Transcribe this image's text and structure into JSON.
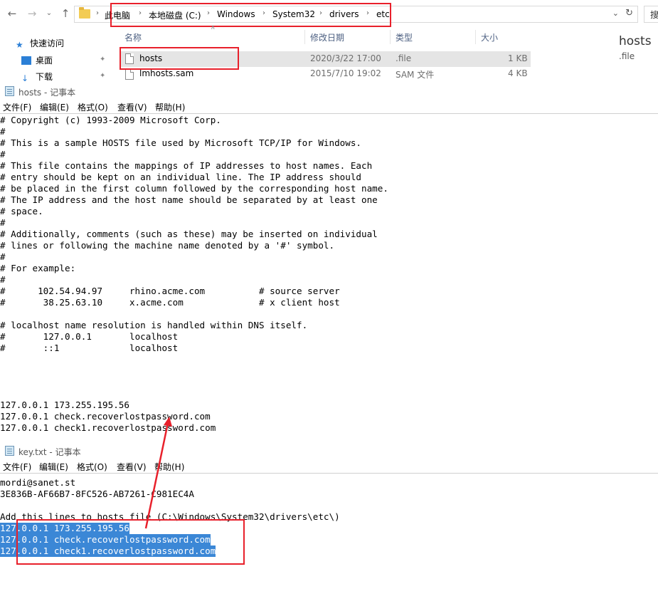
{
  "explorer": {
    "breadcrumb": [
      "此电脑",
      "本地磁盘 (C:)",
      "Windows",
      "System32",
      "drivers",
      "etc"
    ],
    "search_stub": "搜",
    "quick_access": [
      {
        "label": "快速访问",
        "icon": "star-icon"
      },
      {
        "label": "桌面",
        "icon": "desktop-icon"
      },
      {
        "label": "下载",
        "icon": "download-icon"
      }
    ],
    "columns": [
      "名称",
      "修改日期",
      "类型",
      "大小"
    ],
    "files": [
      {
        "name": "hosts",
        "modified": "2020/3/22 17:00",
        "type": ".file",
        "size": "1 KB"
      },
      {
        "name": "lmhosts.sam",
        "modified": "2015/7/10 19:02",
        "type": "SAM 文件",
        "size": "4 KB"
      }
    ],
    "preview": {
      "title": "hosts",
      "subtitle": ".file"
    }
  },
  "notepad_hosts": {
    "title": "hosts - 记事本",
    "menu": [
      "文件(F)",
      "编辑(E)",
      "格式(O)",
      "查看(V)",
      "帮助(H)"
    ],
    "lines": [
      "# Copyright (c) 1993-2009 Microsoft Corp.",
      "#",
      "# This is a sample HOSTS file used by Microsoft TCP/IP for Windows.",
      "#",
      "# This file contains the mappings of IP addresses to host names. Each",
      "# entry should be kept on an individual line. The IP address should",
      "# be placed in the first column followed by the corresponding host name.",
      "# The IP address and the host name should be separated by at least one",
      "# space.",
      "#",
      "# Additionally, comments (such as these) may be inserted on individual",
      "# lines or following the machine name denoted by a '#' symbol.",
      "#",
      "# For example:",
      "#",
      "#      102.54.94.97     rhino.acme.com          # source server",
      "#       38.25.63.10     x.acme.com              # x client host",
      "",
      "# localhost name resolution is handled within DNS itself.",
      "#\t127.0.0.1       localhost",
      "#\t::1             localhost",
      "",
      "",
      "",
      "",
      "127.0.0.1 173.255.195.56",
      "127.0.0.1 check.recoverlostpassword.com",
      "127.0.0.1 check1.recoverlostpassword.com"
    ]
  },
  "notepad_key": {
    "title": "key.txt - 记事本",
    "menu": [
      "文件(F)",
      "编辑(E)",
      "格式(O)",
      "查看(V)",
      "帮助(H)"
    ],
    "lines": [
      "mordi@sanet.st",
      "3E836B-AF66B7-8FC526-AB7261-C981EC4A",
      "",
      "Add this lines to hosts file (C:\\Windows\\System32\\drivers\\etc\\)"
    ],
    "selected_lines": [
      "127.0.0.1 173.255.195.56",
      "127.0.0.1 check.recoverlostpassword.com",
      "127.0.0.1 check1.recoverlostpassword.com"
    ]
  },
  "colors": {
    "annotation_red": "#e8202b",
    "selection_blue": "#3b87d6"
  }
}
